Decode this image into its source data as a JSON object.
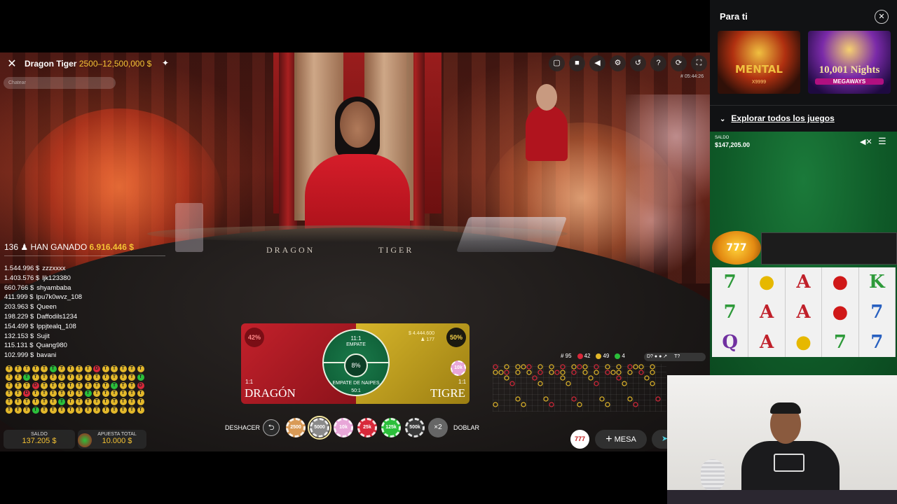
{
  "game": {
    "title": "Dragon Tiger",
    "limits": "2500–12,500,000 $",
    "chat_placeholder": "Chatear",
    "clock": "# 05:44:26",
    "table_left_text": "DRAGON",
    "table_right_text": "TIGER",
    "toolbar_icons": [
      "chat-icon",
      "video-icon",
      "volume-icon",
      "settings-icon",
      "history-icon",
      "help-icon",
      "refresh-icon",
      "fullscreen-icon"
    ]
  },
  "winners": {
    "count": "136",
    "label": "HAN GANADO",
    "total": "6.916.446 $",
    "rows": [
      {
        "amount": "1.544.996 $",
        "user": "zzzxxxx"
      },
      {
        "amount": "1.403.576 $",
        "user": "ljk123380"
      },
      {
        "amount": "660.766 $",
        "user": "shyambaba"
      },
      {
        "amount": "411.999 $",
        "user": "lpu7k0wvz_108"
      },
      {
        "amount": "203.963 $",
        "user": "Queen"
      },
      {
        "amount": "198.229 $",
        "user": "Daffodils1234"
      },
      {
        "amount": "154.499 $",
        "user": "lppjtealq_108"
      },
      {
        "amount": "132.153 $",
        "user": "Sujit"
      },
      {
        "amount": "115.131 $",
        "user": "Quang980"
      },
      {
        "amount": "102.999 $",
        "user": "bavani"
      }
    ]
  },
  "stats": {
    "rounds": "# 95",
    "dragon": "42",
    "tiger": "49",
    "tie": "4",
    "road_tab": "D? ● ● ↗",
    "road_tab2": "T?"
  },
  "bets": {
    "dragon": {
      "label": "DRAGÓN",
      "odds": "1:1",
      "percent": "42%"
    },
    "tiger": {
      "label": "TIGRE",
      "odds": "1:1",
      "percent": "50%",
      "stake_amount": "$ 4.444.600",
      "stake_players": "♟ 177",
      "chip": "10k"
    },
    "tie": {
      "odds": "11:1",
      "label": "EMPATE",
      "percent": "8%",
      "suited_label": "EMPATE DE NAIPES",
      "suited_odds": "50:1"
    }
  },
  "controls": {
    "saldo_label": "SALDO",
    "saldo_value": "137.205 $",
    "apuesta_label": "APUESTA TOTAL",
    "apuesta_value": "10.000 $",
    "undo_label": "DESHACER",
    "double_label": "DOBLAR",
    "x2": "×2",
    "chips": [
      {
        "label": "2500",
        "color": "#d99a56"
      },
      {
        "label": "5000",
        "color": "#8a8a8a"
      },
      {
        "label": "10k",
        "color": "#e8a6d8"
      },
      {
        "label": "25k",
        "color": "#d8283a"
      },
      {
        "label": "125k",
        "color": "#2bbf3a"
      },
      {
        "label": "500k",
        "color": "#3a3a3a"
      }
    ],
    "badge": "777",
    "mesa_label": "MESA"
  },
  "sidebar": {
    "title": "Para ti",
    "games": [
      {
        "title": "MENTAL",
        "sub": "X9999"
      },
      {
        "title": "10,001 Nights",
        "sub": "MEGAWAYS"
      }
    ],
    "explore": "Explorar todos los juegos"
  },
  "slot": {
    "saldo_label": "SALDO",
    "saldo_value": "$147,205.00",
    "logo": "777 Strike",
    "symbols": [
      "7",
      "●",
      "A",
      "●",
      "K",
      "7",
      "A",
      "A",
      "●",
      "7",
      "Q",
      "A",
      "●",
      "7",
      "7"
    ],
    "symbol_colors": [
      "#2e9a3a",
      "#e6b800",
      "#c0202a",
      "#d01818",
      "#2e9a3a",
      "#2e9a3a",
      "#c0202a",
      "#c0202a",
      "#d01818",
      "#2860c0",
      "#7030a0",
      "#c0202a",
      "#e6b800",
      "#2e9a3a",
      "#2860c0"
    ]
  }
}
